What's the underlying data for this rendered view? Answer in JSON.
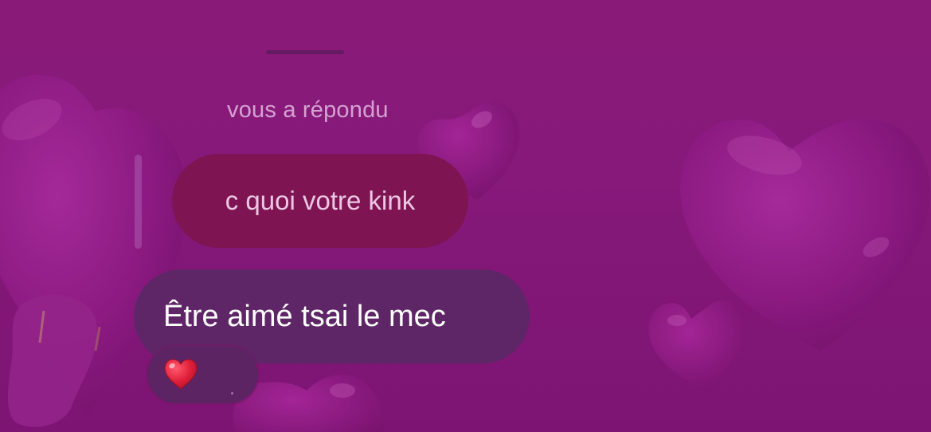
{
  "chat": {
    "reply_status": "vous a répondu",
    "quoted_message": "c quoi votre kink",
    "reply_message": "Être aimé tsai le mec",
    "reaction_icon": "red-heart-icon"
  },
  "colors": {
    "background": "#86197a",
    "quoted_bubble": "#7e1451",
    "reply_bubble": "#5e2666",
    "reaction_heart": "#e0203a"
  }
}
